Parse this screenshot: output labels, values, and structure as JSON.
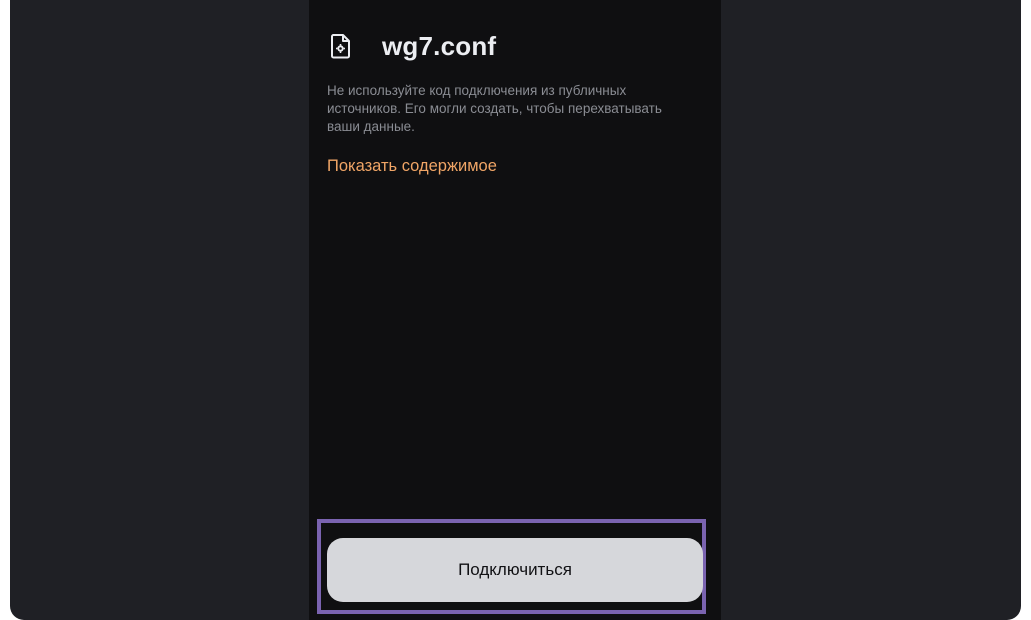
{
  "file": {
    "name": "wg7.conf",
    "icon": "file-settings-icon"
  },
  "warning_text": "Не используйте код подключения из публичных источников. Его могли создать, чтобы перехватывать ваши данные.",
  "show_content_label": "Показать содержимое",
  "connect_label": "Подключиться",
  "colors": {
    "accent_link": "#f0a566",
    "highlight_border": "#7a63b0",
    "button_bg": "#d6d7db",
    "panel_bg": "#0f0f11",
    "window_bg": "#1f2025"
  }
}
